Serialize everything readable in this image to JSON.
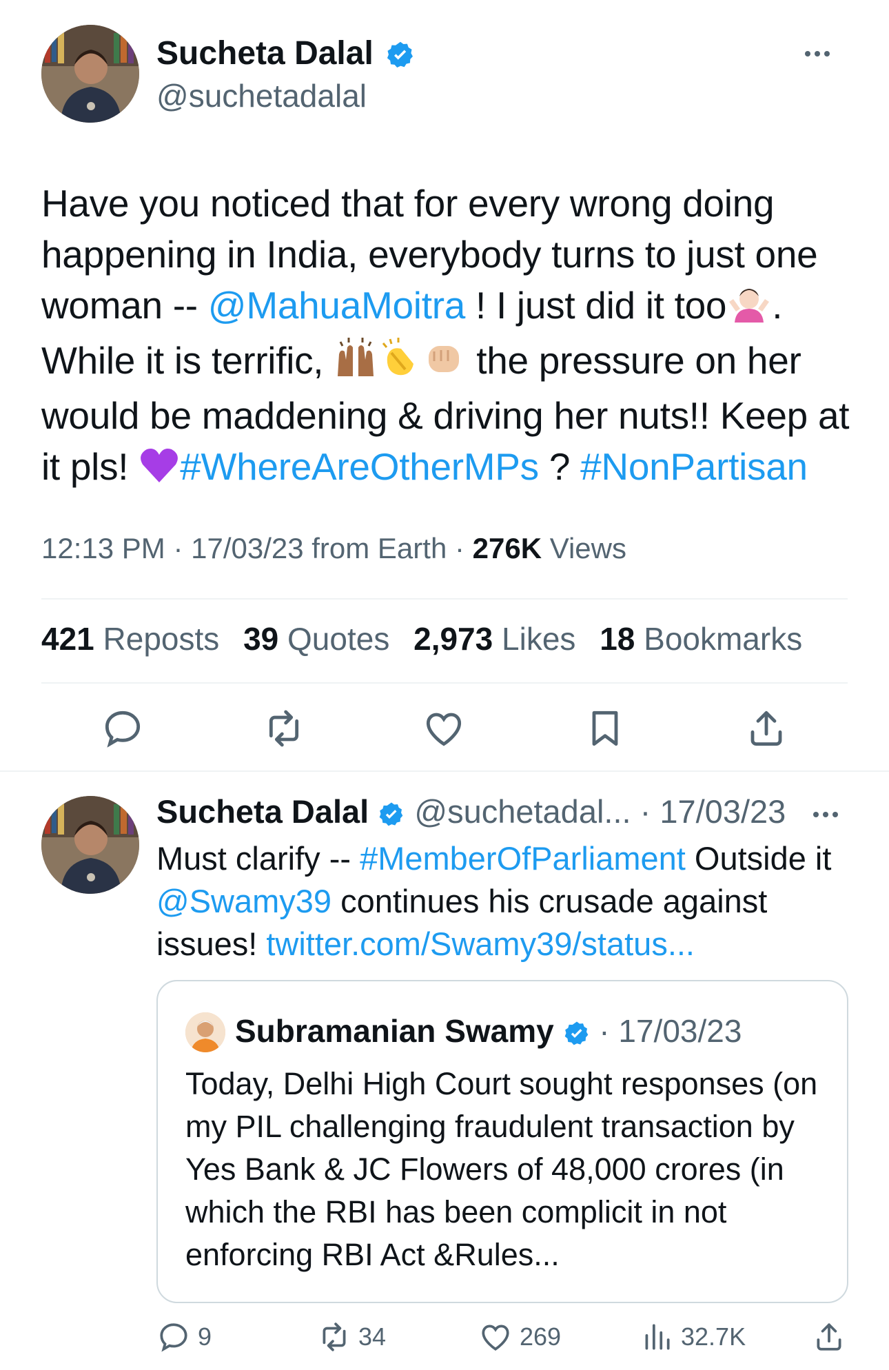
{
  "main_tweet": {
    "author_name": "Sucheta Dalal",
    "author_handle": "@suchetadalal",
    "text_parts": {
      "p1": "Have you noticed that for every wrong doing happening in India, everybody turns to just one woman -- ",
      "mention": "@MahuaMoitra",
      "p2": " ! I just did it too",
      "p3": ". While it is terrific, ",
      "p4": " the pressure on her would be maddening & driving her nuts!! Keep at it pls! ",
      "hashtag1": "#WhereAreOtherMPs",
      "p5": " ? ",
      "hashtag2": "#NonPartisan"
    },
    "timestamp": "12:13 PM · 17/03/23 from Earth · ",
    "views_count": "276K",
    "views_label": " Views",
    "stats": [
      {
        "count": "421",
        "label": "Reposts"
      },
      {
        "count": "39",
        "label": "Quotes"
      },
      {
        "count": "2,973",
        "label": "Likes"
      },
      {
        "count": "18",
        "label": "Bookmarks"
      }
    ]
  },
  "reply_tweet": {
    "author_name": "Sucheta Dalal",
    "author_handle": "@suchetadal...",
    "date": " · 17/03/23",
    "text_parts": {
      "p1": "Must clarify -- ",
      "hashtag": "#MemberOfParliament",
      "p2": " Outside it ",
      "mention": "@Swamy39",
      "p3": " continues his crusade against issues! ",
      "link": "twitter.com/Swamy39/status..."
    },
    "quoted": {
      "author_name": "Subramanian Swamy",
      "date": " · 17/03/23",
      "text": "Today, Delhi High Court sought responses (on my PIL challenging fraudulent transaction by Yes Bank & JC Flowers of 48,000 crores (in which the RBI has been complicit in not enforcing RBI Act &Rules..."
    },
    "actions": {
      "replies": "9",
      "reposts": "34",
      "likes": "269",
      "views": "32.7K"
    }
  },
  "colors": {
    "accent": "#1d9bf0",
    "text": "#0f1419",
    "secondary": "#536471",
    "divider": "#eff3f4"
  }
}
